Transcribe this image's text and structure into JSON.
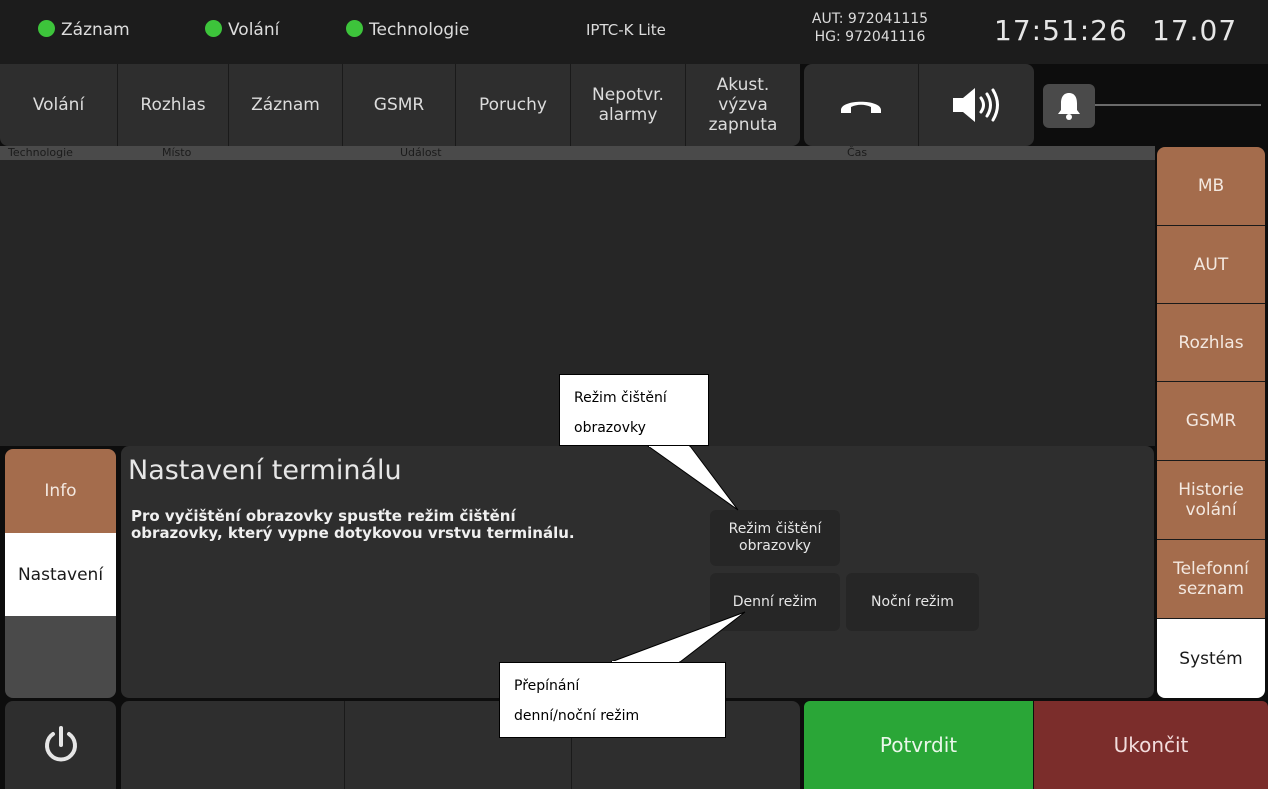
{
  "status": {
    "indicators": [
      {
        "label": "Záznam",
        "color": "#3dc43b"
      },
      {
        "label": "Volání",
        "color": "#3dc43b"
      },
      {
        "label": "Technologie",
        "color": "#3dc43b"
      }
    ],
    "product": "IPTC-K Lite",
    "aut_id": "AUT: 972041115",
    "hg_id": "HG: 972041116",
    "time": "17:51:26",
    "date": "17.07"
  },
  "nav": {
    "items": [
      {
        "label": "Volání"
      },
      {
        "label": "Rozhlas"
      },
      {
        "label": "Záznam"
      },
      {
        "label": "GSMR"
      },
      {
        "label": "Poruchy"
      },
      {
        "label": "Nepotvr.\nalarmy"
      },
      {
        "label": "Akust.\nvýzva\nzapnuta"
      }
    ],
    "icons": [
      "phone-hangup-icon",
      "speaker-icon",
      "bell-icon"
    ]
  },
  "table": {
    "columns": [
      "Technologie",
      "Místo",
      "Událost",
      "Čas"
    ],
    "rows": []
  },
  "right_menu": {
    "items": [
      {
        "label": "MB"
      },
      {
        "label": "AUT"
      },
      {
        "label": "Rozhlas"
      },
      {
        "label": "GSMR"
      },
      {
        "label": "Historie\nvolání"
      },
      {
        "label": "Telefonní\nseznam"
      },
      {
        "label": "Systém",
        "active": true
      }
    ]
  },
  "left_tabs": {
    "items": [
      {
        "label": "Info"
      },
      {
        "label": "Nastavení",
        "active": true
      }
    ]
  },
  "settings": {
    "title": "Nastavení terminálu",
    "description": "Pro vyčištění obrazovky spusťte režim čištění obrazovky, který vypne dotykovou vrstvu terminálu.",
    "clean_button": "Režim čištění\nobrazovky",
    "day_button": "Denní režim",
    "night_button": "Noční režim"
  },
  "callouts": {
    "clean": "Režim čištění\nobrazovky",
    "daynight": "Přepínání\ndenní/noční režim"
  },
  "bottom": {
    "confirm": "Potvrdit",
    "cancel": "Ukončit"
  },
  "colors": {
    "brown": "#a46c4c",
    "green": "#2aa637",
    "red": "#7b2d2b",
    "led": "#3dc43b"
  }
}
